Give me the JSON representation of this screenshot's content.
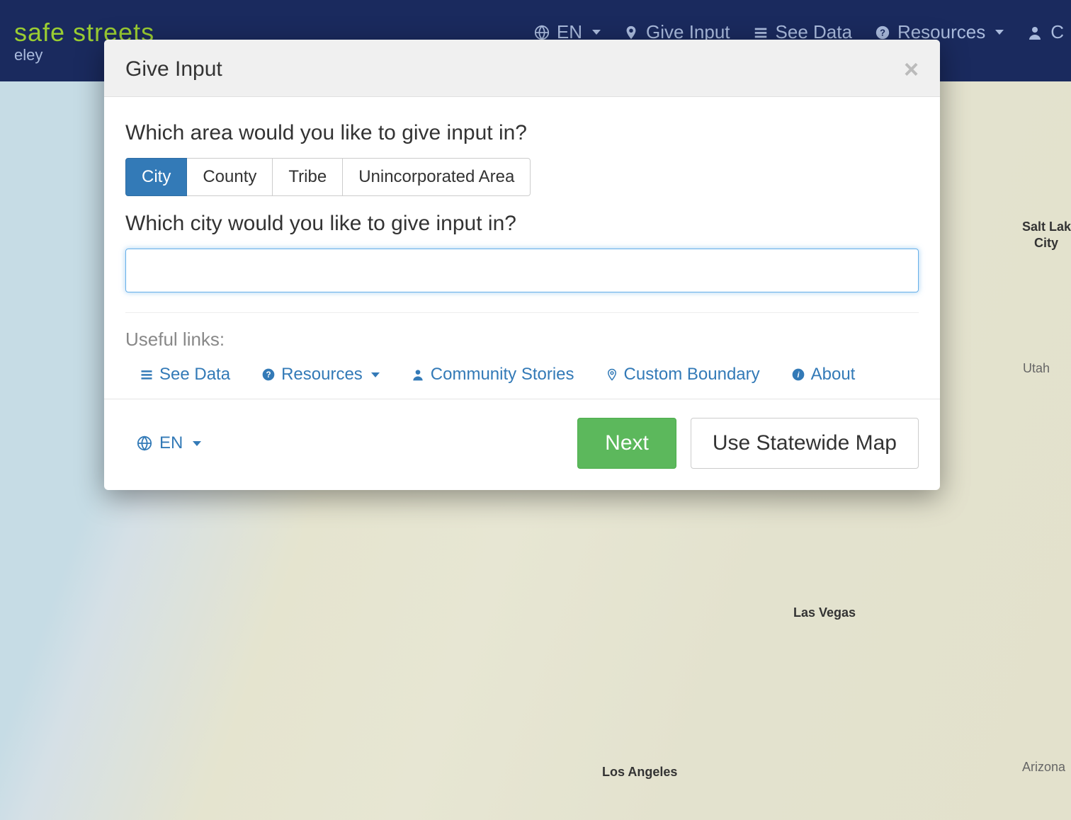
{
  "header": {
    "title": "safe streets",
    "subtitle": "eley",
    "nav": {
      "lang": "EN",
      "give_input": "Give Input",
      "see_data": "See Data",
      "resources": "Resources",
      "account_initial": "C"
    }
  },
  "modal": {
    "title": "Give Input",
    "question_area": "Which area would you like to give input in?",
    "area_options": [
      "City",
      "County",
      "Tribe",
      "Unincorporated Area"
    ],
    "question_city": "Which city would you like to give input in?",
    "city_input_value": "",
    "useful_links_label": "Useful links:",
    "links": {
      "see_data": "See Data",
      "resources": "Resources",
      "community_stories": "Community Stories",
      "custom_boundary": "Custom Boundary",
      "about": "About"
    },
    "footer_lang": "EN",
    "next": "Next",
    "statewide": "Use Statewide Map"
  },
  "map_labels": {
    "salt_lake": "Salt Lak",
    "salt_lake2": "City",
    "utah": "Utah",
    "las_vegas": "Las Vegas",
    "los_angeles": "Los Angeles",
    "arizona": "Arizona"
  }
}
